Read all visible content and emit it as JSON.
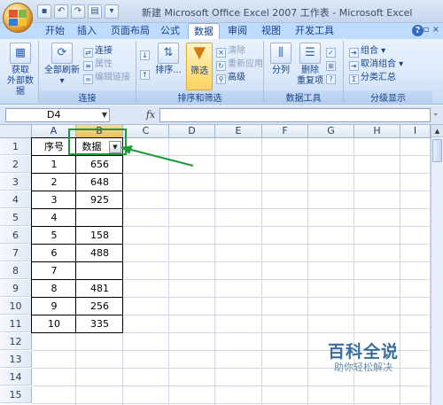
{
  "window": {
    "title": "新建 Microsoft Office Excel 2007 工作表 - Microsoft Excel"
  },
  "quick_access": {
    "save_icon": "save-icon",
    "undo_icon": "undo-icon",
    "redo_icon": "redo-icon",
    "print_preview_icon": "print-preview-icon",
    "customize_icon": "customize-icon"
  },
  "tabs": [
    {
      "label": "开始"
    },
    {
      "label": "插入"
    },
    {
      "label": "页面布局"
    },
    {
      "label": "公式"
    },
    {
      "label": "数据",
      "active": true
    },
    {
      "label": "审阅"
    },
    {
      "label": "视图"
    },
    {
      "label": "开发工具"
    }
  ],
  "ribbon": {
    "get_external": {
      "line1": "获取",
      "line2": "外部数据"
    },
    "connections": {
      "refresh_all": "全部刷新",
      "connections": "连接",
      "properties": "属性",
      "edit_links": "编辑链接",
      "group_label": "连接"
    },
    "sort_filter": {
      "sort": "排序...",
      "filter": "筛选",
      "clear": "清除",
      "reapply": "重新应用",
      "advanced": "高级",
      "group_label": "排序和筛选"
    },
    "data_tools": {
      "text_to_columns": "分列",
      "remove_dup_line1": "删除",
      "remove_dup_line2": "重复项",
      "group_label": "数据工具"
    },
    "outline": {
      "group": "组合",
      "ungroup": "取消组合",
      "subtotal": "分类汇总",
      "group_label": "分级显示"
    }
  },
  "formula_bar": {
    "name_box": "D4",
    "fx": "fx",
    "formula": ""
  },
  "sheet": {
    "columns": [
      "A",
      "B",
      "C",
      "D",
      "E",
      "F",
      "G",
      "H",
      "I"
    ],
    "rows": [
      "1",
      "2",
      "3",
      "4",
      "5",
      "6",
      "7",
      "8",
      "9",
      "10",
      "11",
      "12",
      "13",
      "14",
      "15"
    ],
    "selected_column": "B",
    "data": [
      [
        "序号",
        "数据"
      ],
      [
        "1",
        "656"
      ],
      [
        "2",
        "648"
      ],
      [
        "3",
        "925"
      ],
      [
        "4",
        ""
      ],
      [
        "5",
        "158"
      ],
      [
        "6",
        "488"
      ],
      [
        "7",
        ""
      ],
      [
        "8",
        "481"
      ],
      [
        "9",
        "256"
      ],
      [
        "10",
        "335"
      ]
    ]
  },
  "annotation": {
    "arrow_color": "#1f9a3b"
  },
  "watermark": {
    "title": "百科全说",
    "subtitle": "助你轻松解决"
  }
}
